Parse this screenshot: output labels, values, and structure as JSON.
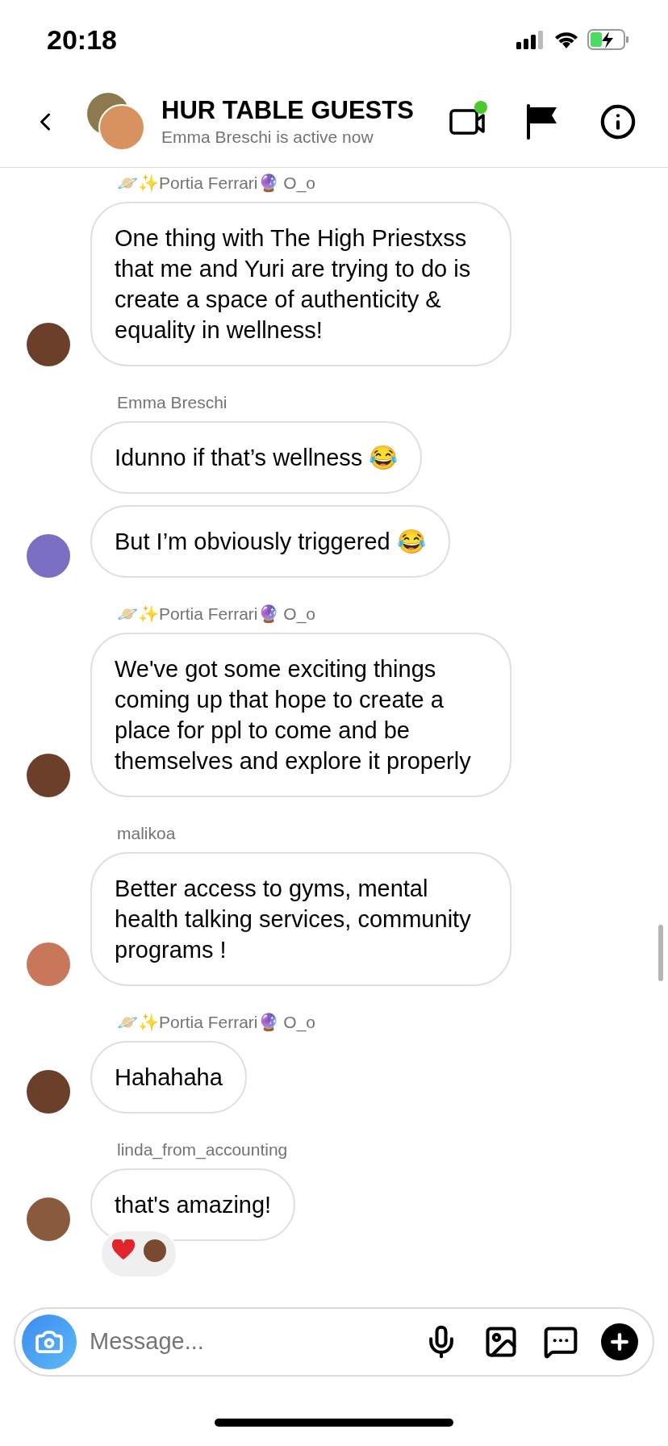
{
  "status_bar": {
    "time": "20:18"
  },
  "header": {
    "title": "HUR TABLE GUESTS",
    "subtitle": "Emma Breschi is active now",
    "video_dot": true
  },
  "groups": [
    {
      "sender": "🪐✨Portia Ferrari🔮 O_o",
      "color": "#6b3f2a",
      "messages": [
        {
          "text": "One thing with The High Priestxss that me and Yuri are trying to do is create a space of authenticity & equality in wellness!",
          "reacted": false
        }
      ]
    },
    {
      "sender": "Emma Breschi",
      "color": "#7a6fc2",
      "messages": [
        {
          "text": "Idunno if that’s wellness 😂",
          "reacted": false
        },
        {
          "text": "But I’m obviously triggered 😂",
          "reacted": false
        }
      ]
    },
    {
      "sender": "🪐✨Portia Ferrari🔮 O_o",
      "color": "#6b3f2a",
      "messages": [
        {
          "text": "We've got some exciting things coming up that hope to create a place for ppl to come and be themselves and explore it properly",
          "reacted": false
        }
      ]
    },
    {
      "sender": "malikoa",
      "color": "#c9775a",
      "messages": [
        {
          "text": "Better access to gyms, mental health talking services, community programs !",
          "reacted": false
        }
      ]
    },
    {
      "sender": "🪐✨Portia Ferrari🔮 O_o",
      "color": "#6b3f2a",
      "messages": [
        {
          "text": "Hahahaha",
          "reacted": false
        }
      ]
    },
    {
      "sender": "linda_from_accounting",
      "color": "#8a5a3c",
      "messages": [
        {
          "text": "that's amazing!",
          "reacted": true
        }
      ]
    }
  ],
  "composer": {
    "placeholder": "Message..."
  }
}
